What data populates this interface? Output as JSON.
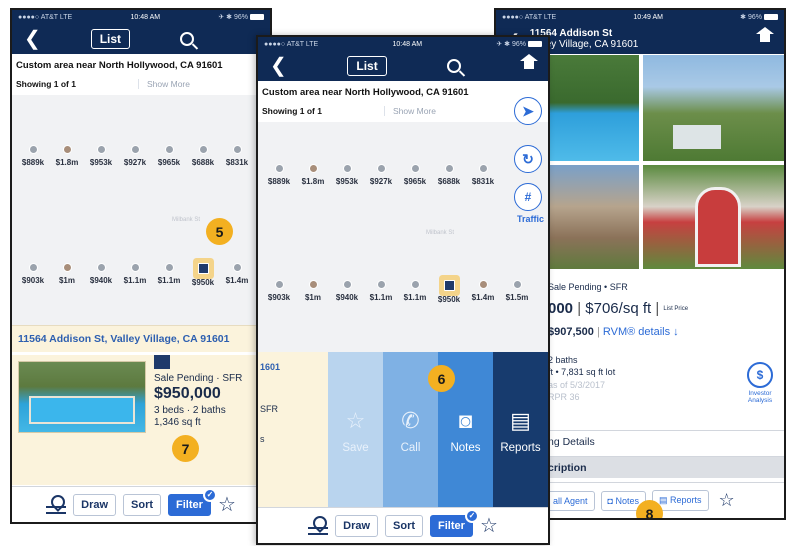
{
  "status": {
    "carrier": "●●●●○ AT&T  LTE",
    "time1": "10:48 AM",
    "time2": "10:48 AM",
    "time3": "10:49 AM",
    "battery": "96%"
  },
  "nav": {
    "back": "❮",
    "list_label": "List"
  },
  "search": {
    "area": "Custom area near North Hollywood, CA 91601",
    "showing": "Showing 1 of 1",
    "show_more": "Show More"
  },
  "map": {
    "street": "Milbank St",
    "row1_prices": [
      "$889k",
      "$1.8m",
      "$953k",
      "$927k",
      "$965k",
      "$688k",
      "$831k"
    ],
    "row2_prices": [
      "$903k",
      "$1m",
      "$940k",
      "$1.1m",
      "$1.1m",
      "$950k",
      "$1.4m",
      "$1.5m"
    ],
    "traffic_label": "Traffic"
  },
  "listing": {
    "address": "11564 Addison St, Valley Village, CA 91601",
    "status": "Sale Pending · SFR",
    "price": "$950,000",
    "beds_baths": "3 beds · 2 baths",
    "sqft": "1,346 sq ft"
  },
  "toolbar": {
    "draw": "Draw",
    "sort": "Sort",
    "filter": "Filter"
  },
  "actions": {
    "save": "Save",
    "call": "Call",
    "notes": "Notes",
    "reports": "Reports"
  },
  "peek": {
    "zip": "1601",
    "type": "SFR",
    "frag": "s"
  },
  "detail": {
    "street": "11564 Addison St",
    "city": "Valley Village, CA 91601",
    "status": "Sale Pending • SFR",
    "price_frag": "000",
    "per_sqft": "$706/sq ft",
    "list_price_label": "List Price",
    "rvm": "$907,500",
    "rvm_label": "RVM® details",
    "baths": "2 baths",
    "lot": "ft • 7,831 sq ft lot",
    "ghost1": "as of 5/3/2017",
    "ghost2": "RPR 36",
    "listing_details": "ng Details",
    "description": "cription",
    "investor": "Investor Analysis",
    "call_agent": "all Agent",
    "notes": "Notes",
    "reports": "Reports"
  },
  "badges": [
    "5",
    "6",
    "7",
    "8"
  ],
  "colors": {
    "navy": "#0f2a55",
    "accent_blue": "#2c6bd6",
    "badge_orange": "#f3b021",
    "card_cream": "#fbf3dc"
  }
}
